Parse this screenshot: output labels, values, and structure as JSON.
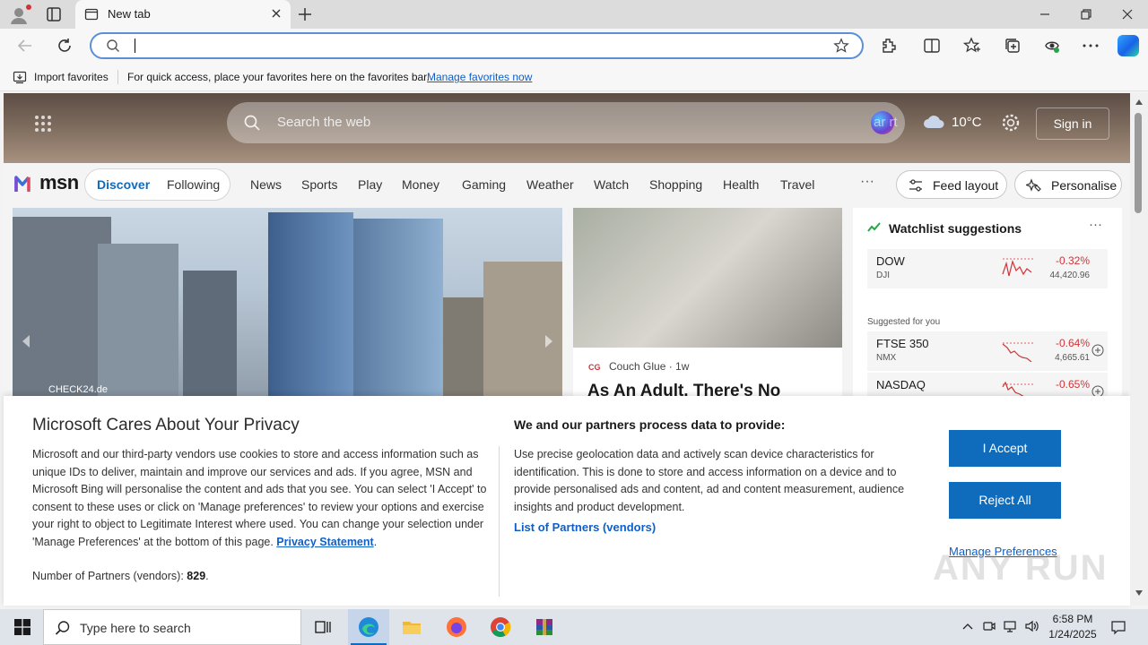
{
  "browser": {
    "tab_title": "New tab",
    "address_value": ""
  },
  "favorites_bar": {
    "import_label": "Import favorites",
    "message": "For quick access, place your favorites here on the favorites bar.",
    "manage_link": "Manage favorites now"
  },
  "msn": {
    "search_placeholder": "Search the web",
    "overlay_text": "ar   rt",
    "weather_temp": "10°C",
    "signin_label": "Sign in",
    "logo_text": "msn",
    "pill_active": "Discover",
    "pill_item": "Following",
    "nav_items": [
      "News",
      "Sports",
      "Play",
      "Money",
      "Gaming",
      "Weather",
      "Watch",
      "Shopping",
      "Health",
      "Travel"
    ],
    "nav_more": "···",
    "feed_layout_label": "Feed layout",
    "personalise_label": "Personalise"
  },
  "cards": {
    "main_source": "CHECK24.de",
    "second_source": "Couch Glue",
    "second_age": " · 1w",
    "second_title": "As An Adult, There's No"
  },
  "watchlist": {
    "title": "Watchlist suggestions",
    "more": "···",
    "suggested_label": "Suggested for you",
    "stocks": [
      {
        "name": "DOW",
        "exchange": "DJI",
        "change": "-0.32%",
        "value": "44,420.96"
      },
      {
        "name": "FTSE 350",
        "exchange": "NMX",
        "change": "-0.64%",
        "value": "4,665.61"
      },
      {
        "name": "NASDAQ",
        "exchange": "",
        "change": "-0.65%",
        "value": ""
      }
    ]
  },
  "privacy": {
    "title": "Microsoft Cares About Your Privacy",
    "body": "Microsoft and our third-party vendors use cookies to store and access information such as unique IDs to deliver, maintain and improve our services and ads. If you agree, MSN and Microsoft Bing will personalise the content and ads that you see. You can select 'I Accept' to consent to these uses or click on 'Manage preferences' to review your options and exercise your right to object to Legitimate Interest where used.  You can change your selection under 'Manage Preferences' at the bottom of this page. ",
    "privacy_link": "Privacy Statement",
    "partners_label": "Number of Partners (vendors): ",
    "partners_count": "829",
    "heading2": "We and our partners process data to provide:",
    "body2": "Use precise geolocation data and actively scan device characteristics for identification. This is done to store and access information on a device and to provide personalised ads and content, ad and content measurement, audience insights and product development.",
    "list_link": "List of Partners (vendors)",
    "accept_label": "I Accept",
    "reject_label": "Reject All",
    "manage_label": "Manage Preferences",
    "watermark": "ANY RUN"
  },
  "taskbar": {
    "search_placeholder": "Type here to search",
    "time": "6:58 PM",
    "date": "1/24/2025"
  },
  "colors": {
    "accent": "#0f6cbd",
    "link": "#0f5fc6",
    "negative": "#d13438"
  }
}
